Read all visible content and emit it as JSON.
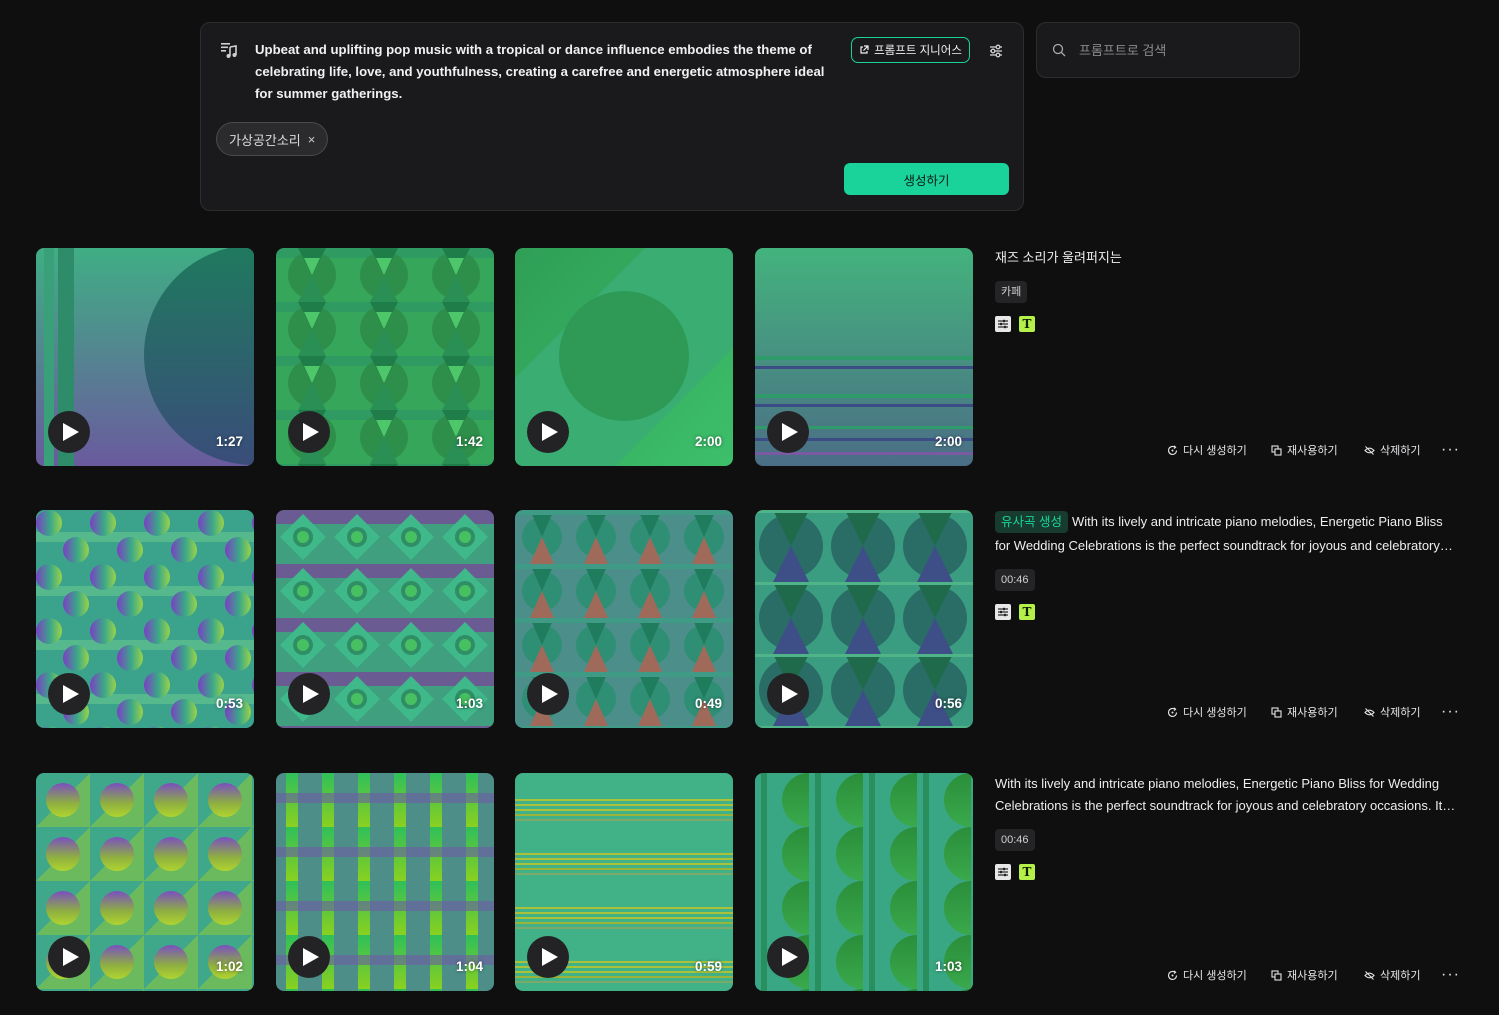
{
  "composer": {
    "prompt_text": "Upbeat and uplifting pop music with a tropical or dance influence embodies the theme of celebrating life, love, and youthfulness, creating a carefree and energetic atmosphere ideal for summer gatherings.",
    "genius_label": "프롬프트 지니어스",
    "tag_label": "가상공간소리",
    "tag_close": "×",
    "generate_label": "생성하기",
    "accent_color": "#19d39a"
  },
  "search": {
    "placeholder": "프롬프트로 검색"
  },
  "rows": [
    {
      "tracks": [
        {
          "duration": "1:27",
          "art": "stripe-circle"
        },
        {
          "duration": "1:42",
          "art": "hourglass-grid"
        },
        {
          "duration": "2:00",
          "art": "diagonal-circle"
        },
        {
          "duration": "2:00",
          "art": "horizontal-lines"
        }
      ],
      "title": "재즈 소리가 울려퍼지는",
      "chip": "카페",
      "actions": {
        "regenerate": "다시 생성하기",
        "reuse": "재사용하기",
        "delete": "삭제하기",
        "more": "···"
      }
    },
    {
      "tracks": [
        {
          "duration": "0:53",
          "art": "circle-grid"
        },
        {
          "duration": "1:03",
          "art": "diamond-grid"
        },
        {
          "duration": "0:49",
          "art": "hourglass-dense"
        },
        {
          "duration": "0:56",
          "art": "hourglass-large"
        }
      ],
      "badge": "유사곡 생성",
      "description": "With its lively and intricate piano melodies, Energetic Piano Bliss for Wedding Celebrations is the perfect soundtrack for joyous and celebratory occasions. Its upbeat tempo and catchy rhythms create an atmosphere of joy and celebration.",
      "chip": "00:46",
      "actions": {
        "regenerate": "다시 생성하기",
        "reuse": "재사용하기",
        "delete": "삭제하기",
        "more": "···"
      }
    },
    {
      "tracks": [
        {
          "duration": "1:02",
          "art": "diagonal-circle-grid"
        },
        {
          "duration": "1:04",
          "art": "vertical-bars"
        },
        {
          "duration": "0:59",
          "art": "thin-lines"
        },
        {
          "duration": "1:03",
          "art": "half-circle-columns"
        }
      ],
      "description": "With its lively and intricate piano melodies, Energetic Piano Bliss for Wedding Celebrations is the perfect soundtrack for joyous and celebratory occasions. Its upbeat tempo and catchy rhythms create an atmosphere of joy and celebration.",
      "chip": "00:46",
      "actions": {
        "regenerate": "다시 생성하기",
        "reuse": "재사용하기",
        "delete": "삭제하기",
        "more": "···"
      }
    }
  ]
}
